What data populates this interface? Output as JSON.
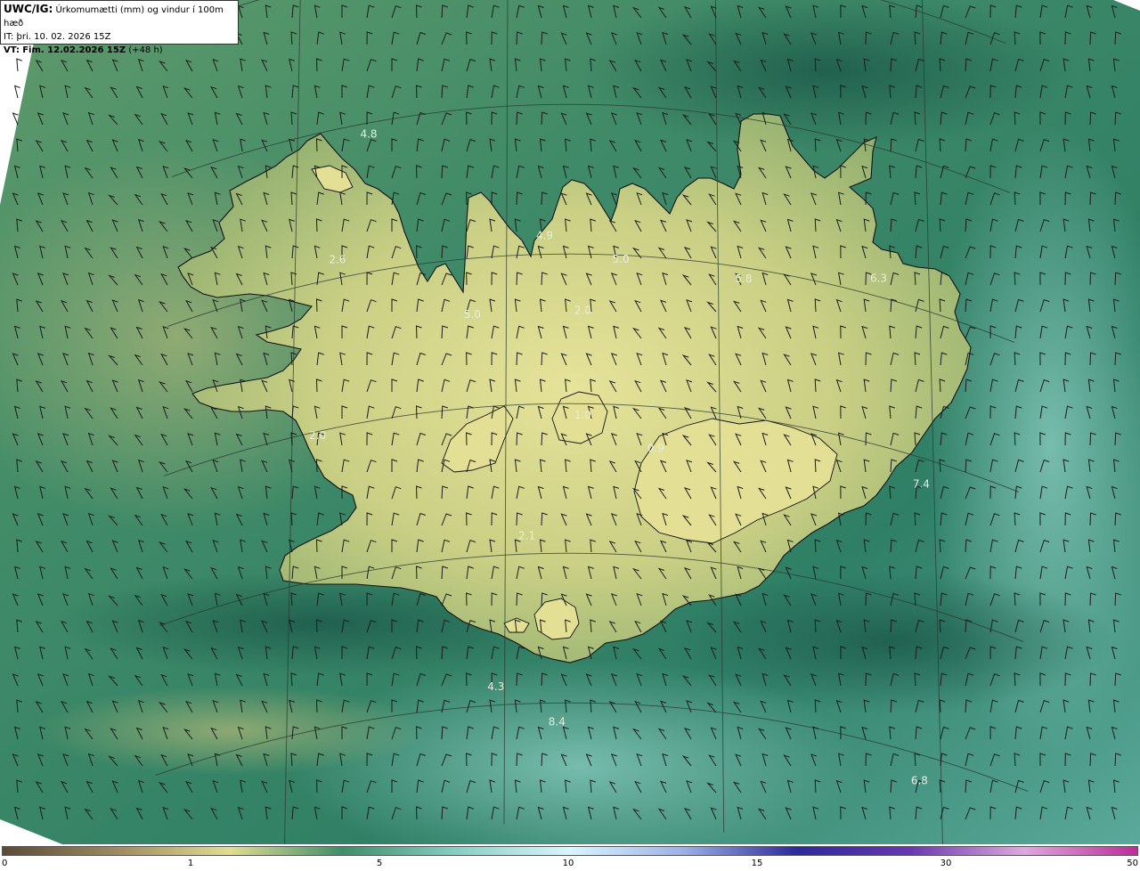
{
  "header": {
    "model": "UWC/IG:",
    "title": "Úrkomumætti (mm) og vindur í 100m hæð",
    "it_label": "IT:",
    "it_value": "þri. 10. 02. 2026 15Z",
    "vt_label": "VT:",
    "vt_value": "Fim. 12.02.2026 15Z",
    "lead": "(+48 h)"
  },
  "value_labels": [
    {
      "text": "5.3",
      "lon": -13.7,
      "lat": 67.9
    },
    {
      "text": "4.8",
      "lon": -23.3,
      "lat": 66.9
    },
    {
      "text": "2.6",
      "lon": -24.0,
      "lat": 66.1
    },
    {
      "text": "4.9",
      "lon": -19.1,
      "lat": 66.1
    },
    {
      "text": "5.0",
      "lon": -17.3,
      "lat": 65.95
    },
    {
      "text": "5.8",
      "lon": -14.4,
      "lat": 65.9
    },
    {
      "text": "6.3",
      "lon": -11.2,
      "lat": 66.1
    },
    {
      "text": "5.0",
      "lon": -20.8,
      "lat": 65.6
    },
    {
      "text": "2.0",
      "lon": -18.2,
      "lat": 65.6
    },
    {
      "text": "2.0",
      "lon": -24.4,
      "lat": 64.95
    },
    {
      "text": "1.0",
      "lon": -18.2,
      "lat": 64.9
    },
    {
      "text": "0.9",
      "lon": -16.5,
      "lat": 64.7
    },
    {
      "text": "7.4",
      "lon": -10.3,
      "lat": 64.8
    },
    {
      "text": "2.1",
      "lon": -19.5,
      "lat": 64.1
    },
    {
      "text": "4.3",
      "lon": -20.2,
      "lat": 63.1
    },
    {
      "text": "8.4",
      "lon": -18.8,
      "lat": 62.85
    },
    {
      "text": "6.8",
      "lon": -10.5,
      "lat": 62.8
    }
  ],
  "scale": {
    "ticks": [
      "0",
      "1",
      "5",
      "10",
      "15",
      "30",
      "50"
    ],
    "tick_values": [
      0,
      1,
      5,
      10,
      15,
      30,
      50
    ],
    "colors": [
      "#5c4a36",
      "#9e8a5e",
      "#e2dd90",
      "#3e8e6a",
      "#86cfc4",
      "#d8f6ff",
      "#9ab0e8",
      "#2a2a9c",
      "#6a36b4",
      "#dea8de",
      "#c02a9c"
    ]
  },
  "colors": {
    "sea_dark": "#1f5c4e",
    "sea_mid": "#3d8a6c",
    "land_low": "#88aa6a",
    "land_high": "#d8dc8c",
    "coast": "#111111"
  }
}
